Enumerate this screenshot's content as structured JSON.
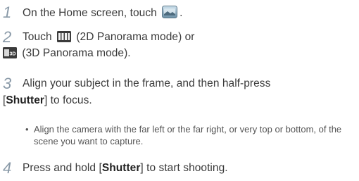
{
  "steps": [
    {
      "number": "1",
      "text_before": "On the Home screen, touch",
      "icon": "camera-app-icon",
      "text_after": "."
    },
    {
      "number": "2",
      "text_before": "Touch",
      "icon_a": "panorama-2d-icon",
      "text_mid": "(2D Panorama mode) or",
      "icon_b": "panorama-3d-icon",
      "text_after": "(3D Panorama mode)."
    },
    {
      "number": "3",
      "line1": "Align your subject in the frame, and then half-press",
      "bracket_open": "[",
      "key": "Shutter",
      "bracket_close": "]",
      "line2_rest": " to focus.",
      "bullet": "•",
      "bullet_text": "Align the camera with the far left or the far right, or very top or bottom, of the scene you want to capture."
    },
    {
      "number": "4",
      "text_before": "Press and hold [",
      "key": "Shutter",
      "text_after": "] to start shooting."
    }
  ],
  "colors": {
    "step_number": "#8a9aa8",
    "text": "#3a3a3a"
  }
}
